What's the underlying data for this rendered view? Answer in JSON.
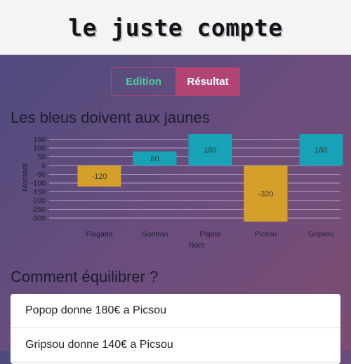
{
  "app": {
    "title": "le juste compte"
  },
  "tabs": {
    "edition_label": "Edition",
    "resultat_label": "Résultat"
  },
  "result": {
    "heading": "Les bleus doivent aux jaunes"
  },
  "balance": {
    "heading": "Comment équilibrer ?"
  },
  "transfers": [
    "Popop donne 180€ a Picsou",
    "Gripsou donne 140€ a Picsou"
  ],
  "colors": {
    "positive": "#17a2b8",
    "negative": "#d4a02a",
    "active_tab": "#b14473",
    "edition_text": "#4ecf9a"
  },
  "chart_data": {
    "type": "bar",
    "categories": [
      "Flagada",
      "Gontran",
      "Popop",
      "Picsou",
      "Gripsou"
    ],
    "values": [
      -120,
      80,
      180,
      -320,
      180
    ],
    "xlabel": "Nom",
    "ylabel": "Montant",
    "yticks": [
      150,
      100,
      50,
      0,
      -50,
      -100,
      -150,
      -200,
      -250,
      -300
    ],
    "ylim": [
      -320,
      180
    ],
    "grid": true
  }
}
